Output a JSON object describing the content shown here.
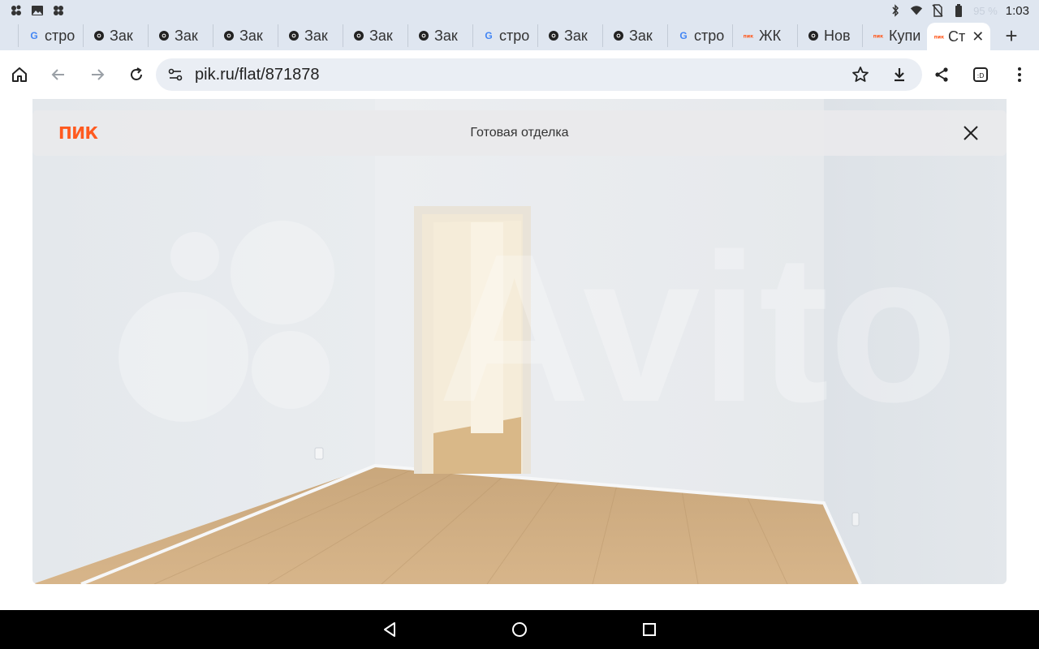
{
  "status_bar": {
    "left_icons": [
      "apps-icon",
      "gallery-icon",
      "apps-icon"
    ],
    "battery_percent": "95 %",
    "time": "1:03"
  },
  "tabs": [
    {
      "label": "стро",
      "favicon": "google-icon"
    },
    {
      "label": "Зак",
      "favicon": "chrome-icon"
    },
    {
      "label": "Зак",
      "favicon": "chrome-icon"
    },
    {
      "label": "Зак",
      "favicon": "chrome-icon"
    },
    {
      "label": "Зак",
      "favicon": "chrome-icon"
    },
    {
      "label": "Зак",
      "favicon": "chrome-icon"
    },
    {
      "label": "Зак",
      "favicon": "chrome-icon"
    },
    {
      "label": "стро",
      "favicon": "google-icon"
    },
    {
      "label": "Зак",
      "favicon": "chrome-icon"
    },
    {
      "label": "Зак",
      "favicon": "chrome-icon"
    },
    {
      "label": "стро",
      "favicon": "google-icon"
    },
    {
      "label": "ЖК",
      "favicon": "pik-icon"
    },
    {
      "label": "Нов",
      "favicon": "chrome-icon"
    },
    {
      "label": "Купи",
      "favicon": "pik-icon"
    }
  ],
  "active_tab": {
    "label": "Ст",
    "favicon": "pik-icon",
    "close": "✕"
  },
  "new_tab": "+",
  "address": {
    "url": "pik.ru/flat/871878"
  },
  "overlay": {
    "logo": "ПИК",
    "title": "Готовая отделка"
  },
  "photo": {
    "watermark": "Avito"
  },
  "colors": {
    "brand_orange": "#ff5a1f",
    "chrome_frame": "#dfe6f0",
    "omnibox": "#eaeef4"
  }
}
